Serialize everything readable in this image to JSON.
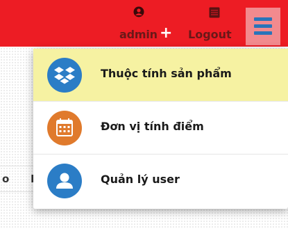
{
  "header": {
    "user_label": "admin",
    "user_plus": "+",
    "logout_label": "Logout",
    "bar_color": "#ed1c24",
    "toggle_color": "#f28a8e",
    "toggle_icon": "hamburger-menu-icon"
  },
  "background": {
    "row_cells": [
      "o",
      "N"
    ]
  },
  "menu": {
    "items": [
      {
        "label": "Thuộc tính sản phẩm",
        "icon": "dropbox-boxes-icon",
        "icon_color": "#2b7dc6",
        "active": true
      },
      {
        "label": "Đơn vị tính điểm",
        "icon": "calendar-icon",
        "icon_color": "#e07a2c",
        "active": false
      },
      {
        "label": "Quản lý user",
        "icon": "user-icon",
        "icon_color": "#2b7dc6",
        "active": false
      }
    ]
  }
}
